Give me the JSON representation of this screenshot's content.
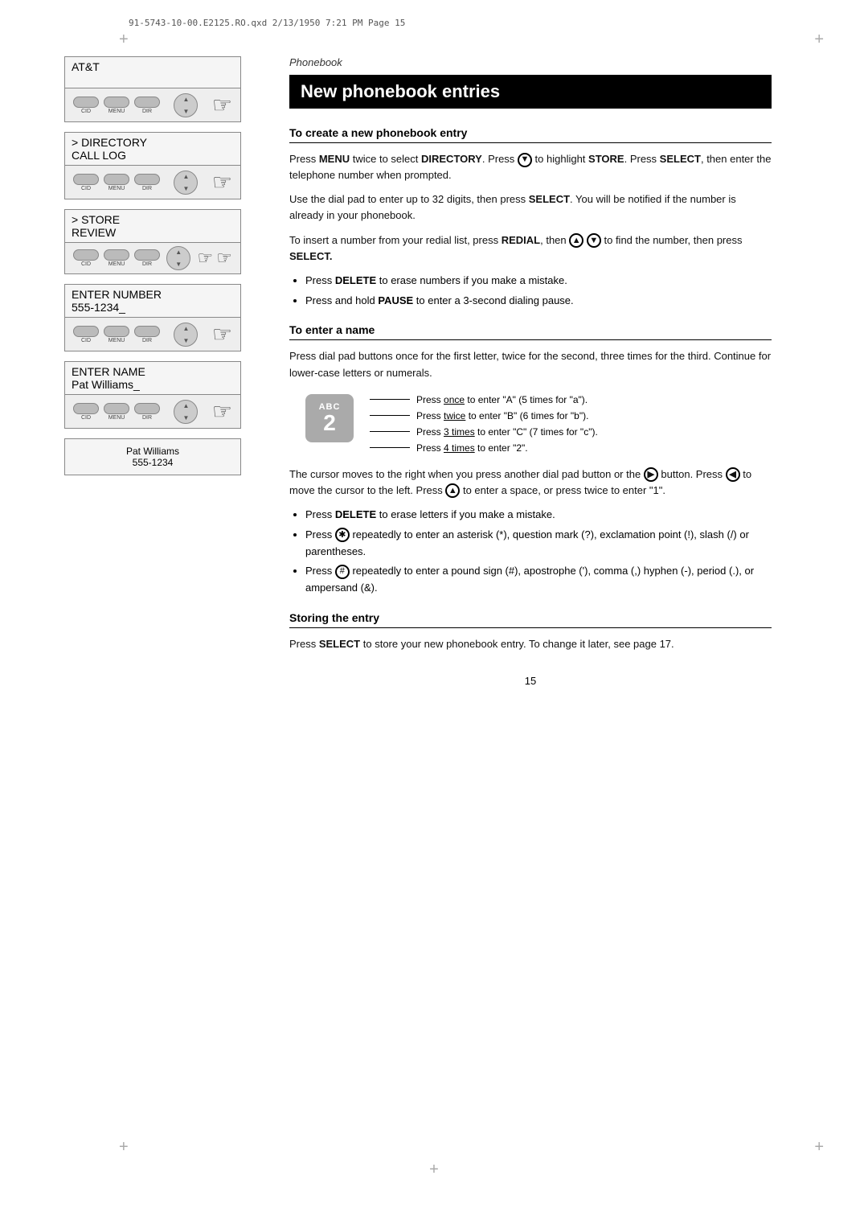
{
  "meta": {
    "file_info": "91-5743-10-00.E2125.RO.qxd  2/13/1950  7:21 PM  Page 15"
  },
  "section_title": "Phonebook",
  "main_heading": "New phonebook entries",
  "subsections": [
    {
      "id": "create",
      "heading": "To create a new phonebook entry",
      "paragraphs": [
        "Press MENU twice to select DIRECTORY. Press ⓿ to highlight STORE. Press SELECT, then enter the telephone number when prompted.",
        "Use the dial pad to enter up to 32 digits, then press SELECT. You will be notified if the number is already in your phonebook.",
        "To insert a number from your redial list, press REDIAL, then ⓿ ⓿ to find the number, then press SELECT."
      ],
      "bullets": [
        "Press DELETE to erase numbers if you make a mistake.",
        "Press and hold PAUSE to enter a 3-second dialing pause."
      ]
    },
    {
      "id": "name",
      "heading": "To enter a name",
      "paragraphs": [
        "Press dial pad buttons once for the first letter, twice for the second, three times for the third. Continue for lower-case letters or numerals."
      ],
      "abc_diagram": {
        "letters": "ABC",
        "number": "2",
        "lines": [
          "Press once to enter \"A\" (5 times for \"a\").",
          "Press twice to enter \"B\" (6 times for \"b\").",
          "Press 3 times to enter \"C\" (7 times for \"c\").",
          "Press 4 times to enter \"2\"."
        ],
        "underlines": [
          "once",
          "twice",
          "3 times",
          "4 times"
        ]
      },
      "paragraphs2": [
        "The cursor moves to the right when you press another dial pad button or the ⓿ button. Press ⓿ to move the cursor to the left. Press ⓿ to enter a space, or press twice to enter \"1\"."
      ],
      "bullets2": [
        "Press DELETE to erase letters if you make a mistake.",
        "Press ✱ repeatedly to enter an asterisk (*), question mark (?), exclamation point (!), slash (/) or parentheses.",
        "Press # repeatedly to enter a pound sign (#), apostrophe ('), comma (,) hyphen (-), period (.), or ampersand (&)."
      ]
    },
    {
      "id": "store",
      "heading": "Storing the entry",
      "paragraphs": [
        "Press SELECT to store your new phonebook entry. To change it later, see page 17."
      ]
    }
  ],
  "page_number": "15",
  "phone_displays": [
    {
      "id": "att",
      "screen_text": "AT&T",
      "screen_label": "",
      "screen_value": ""
    },
    {
      "id": "directory",
      "screen_label": "> DIRECTORY",
      "screen_value": "CALL LOG"
    },
    {
      "id": "store",
      "screen_label": "> STORE",
      "screen_value": "REVIEW"
    },
    {
      "id": "enter_number",
      "screen_label": "ENTER NUMBER",
      "screen_value": "555-1234_"
    },
    {
      "id": "enter_name",
      "screen_label": "ENTER NAME",
      "screen_value": "Pat Williams_"
    }
  ],
  "final_display": {
    "line1": "Pat Williams",
    "line2": "555-1234"
  },
  "buttons": {
    "labels": [
      "CID",
      "MENU",
      "DIR"
    ]
  }
}
